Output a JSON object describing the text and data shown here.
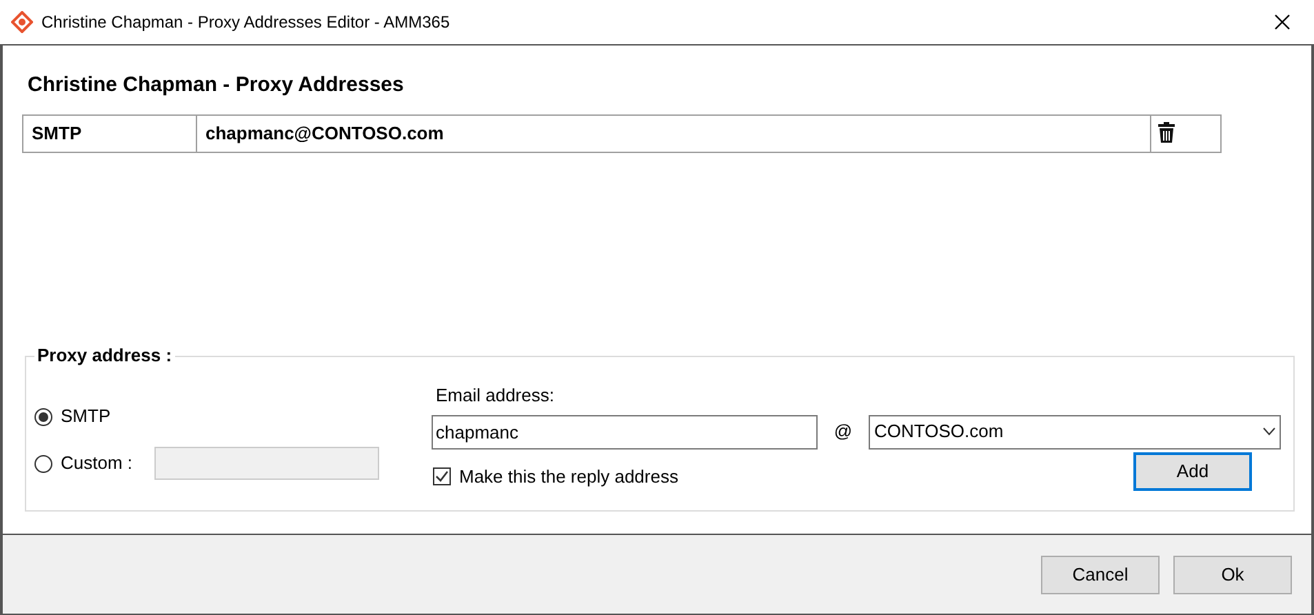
{
  "window": {
    "title": "Christine Chapman - Proxy Addresses Editor - AMM365"
  },
  "heading": "Christine Chapman - Proxy Addresses",
  "addresses": [
    {
      "type": "SMTP",
      "address": "chapmanc@CONTOSO.com"
    }
  ],
  "proxy_address": {
    "label": "Proxy address :",
    "types": [
      {
        "label": "SMTP",
        "selected": true,
        "kind": "plain"
      },
      {
        "label": "Custom :",
        "selected": false,
        "kind": "custom"
      }
    ],
    "email_label": "Email address:",
    "email_value": "chapmanc",
    "at": "@",
    "domain": "CONTOSO.com",
    "reply_checkbox": {
      "label": "Make this the reply address",
      "checked": true
    },
    "add_button": "Add"
  },
  "buttons": [
    "Cancel",
    "Ok"
  ]
}
